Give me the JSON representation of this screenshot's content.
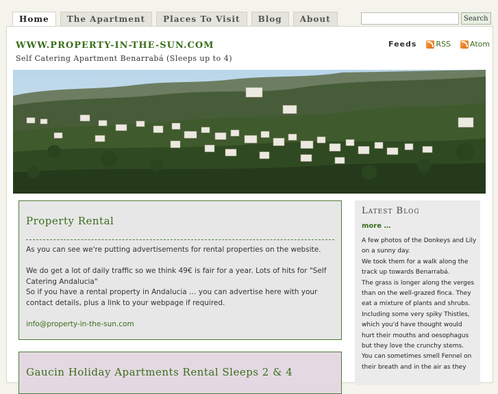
{
  "nav": {
    "tabs": [
      {
        "label": "Home"
      },
      {
        "label": "The Apartment"
      },
      {
        "label": "Places To Visit"
      },
      {
        "label": "Blog"
      },
      {
        "label": "About"
      }
    ]
  },
  "search": {
    "placeholder": "",
    "value": "",
    "button_label": "Search"
  },
  "header": {
    "site_title": "WWW.PROPERTY-IN-THE-SUN.COM",
    "tagline": "Self Catering Apartment Benarrabá (Sleeps up to 4)",
    "feeds_label": "Feeds",
    "feed_rss": "RSS",
    "feed_atom": "Atom"
  },
  "posts": [
    {
      "title": "Property Rental",
      "paragraphs": [
        "As you can see we're putting advertisements for rental properties on the website.",
        "",
        "We do get a lot of daily traffic so we think  49€ is fair for a year. Lots of hits for \"Self Catering Andalucia\"",
        "So if you have a rental property in Andalucia … you can advertise here with your contact details, plus a link to your webpage if required.",
        ""
      ],
      "email": "info@property-in-the-sun.com"
    },
    {
      "title": "Gaucin Holiday Apartments Rental Sleeps 2 & 4"
    }
  ],
  "sidebar": {
    "title": "Latest Blog",
    "more": "more …",
    "lines": [
      "A few photos of the Donkeys and Lily on a sunny day.",
      "We took them for a walk along the track up towards Benarrabá.",
      "The grass is longer along the verges than on the well-grazed finca. They eat a mixture of plants and shrubs. Including some very spiky Thistles, which you'd have thought would hurt their mouths and oesophagus but they love the crunchy stems.",
      "You can sometimes smell Fennel on their breath and in the air as they"
    ]
  }
}
